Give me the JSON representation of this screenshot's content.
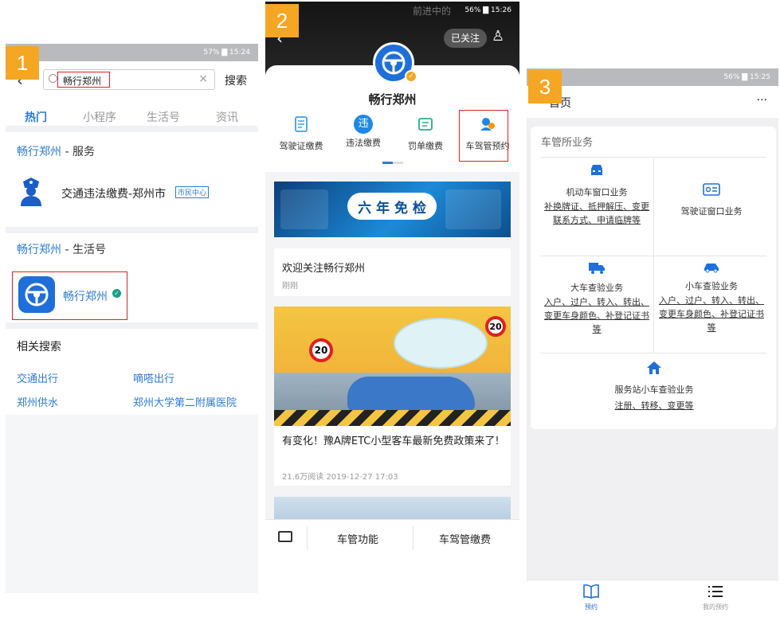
{
  "badges": {
    "b1": "1",
    "b2": "2",
    "b3": "3"
  },
  "panel1": {
    "status_right": "57% ▇ 15:24",
    "search_value": "畅行郑州",
    "search_button": "搜索",
    "tabs": [
      "热门",
      "小程序",
      "生活号",
      "资讯"
    ],
    "service_section": {
      "brand": "畅行郑州",
      "suffix": " - 服务"
    },
    "service_item": {
      "title": "交通违法缴费-郑州市",
      "tag": "市民中心"
    },
    "life_section": {
      "brand": "畅行郑州",
      "suffix": " - 生活号"
    },
    "life_item": {
      "title": "畅行郑州"
    },
    "related_title": "相关搜索",
    "related": [
      "交通出行",
      "嘀嗒出行",
      "郑州供水",
      "郑州大学第二附属医院"
    ]
  },
  "panel2": {
    "status_center": "前进中的",
    "status_right": "56% ▇ 15:26",
    "follow_button": "已关注",
    "account_name": "畅行郑州",
    "services": [
      "驾驶证缴费",
      "违法缴费",
      "罚单缴费",
      "车驾管预约"
    ],
    "banner_text": "六 年 免 检",
    "welcome_title": "欢迎关注畅行郑州",
    "welcome_time": "刚刚",
    "article_title": "有变化！豫A牌ETC小型客车最新免费政策来了!",
    "article_meta": "21.6万阅读 2019-12-27 17:03",
    "bottom_menu": [
      "车管功能",
      "车驾管缴费"
    ]
  },
  "panel3": {
    "status_right": "56% ▇ 15:25",
    "nav_title": "首页",
    "more": "···",
    "section_title": "车管所业务",
    "items": [
      {
        "title": "机动车窗口业务",
        "desc": "补换牌证、抵押解压、变更联系方式、申请临牌等"
      },
      {
        "title": "驾驶证窗口业务",
        "desc": ""
      },
      {
        "title": "大车查验业务",
        "desc": "入户、过户、转入、转出、变更车身颜色、补登记证书等"
      },
      {
        "title": "小车查验业务",
        "desc": "入户、过户、转入、转出、变更车身颜色、补登记证书等"
      },
      {
        "title": "服务站小车查验业务",
        "desc": "注册、转移、变更等"
      }
    ],
    "tabbar": [
      "预约",
      "我的预约"
    ]
  }
}
